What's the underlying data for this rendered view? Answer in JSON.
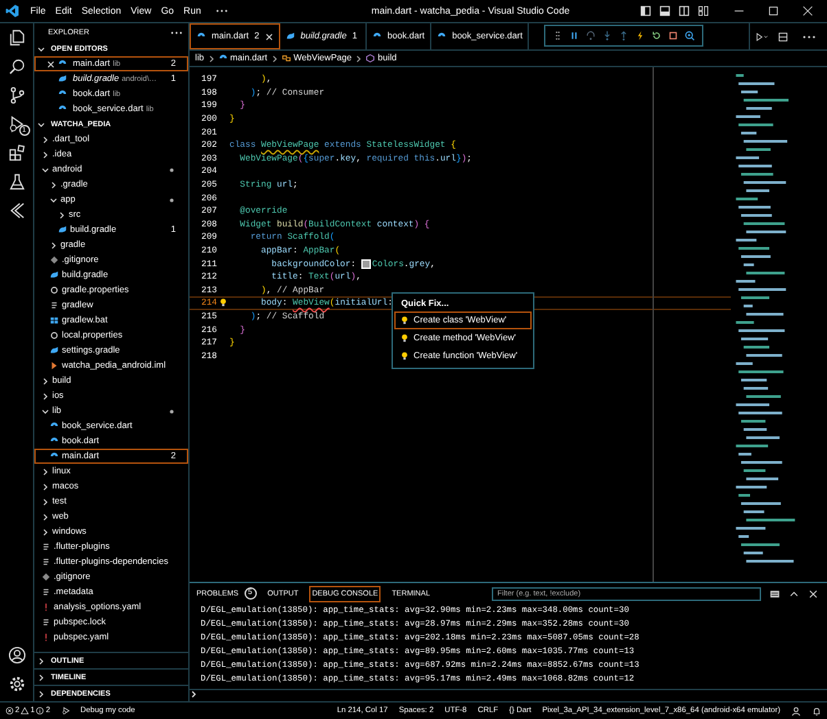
{
  "title_bar": {
    "menu": [
      "File",
      "Edit",
      "Selection",
      "View",
      "Go",
      "Run"
    ],
    "title": "main.dart - watcha_pedia - Visual Studio Code"
  },
  "activity_bar": {
    "items": [
      {
        "kind": "files"
      },
      {
        "kind": "search"
      },
      {
        "kind": "source-control"
      },
      {
        "kind": "debug",
        "badge": "1"
      },
      {
        "kind": "extensions"
      },
      {
        "kind": "testing"
      },
      {
        "kind": "flutter"
      }
    ],
    "bottom": [
      {
        "kind": "account"
      },
      {
        "kind": "settings"
      }
    ]
  },
  "sidebar": {
    "title": "EXPLORER",
    "open_editors": {
      "title": "OPEN EDITORS",
      "expanded": true,
      "items": [
        {
          "name": "main.dart",
          "detail": "lib",
          "badge": "2",
          "kind": "dart",
          "preview": false,
          "selected": true
        },
        {
          "name": "build.gradle",
          "detail": "android\\…",
          "badge": "1",
          "kind": "gradle",
          "preview": true,
          "selected": false
        },
        {
          "name": "book.dart",
          "detail": "lib",
          "kind": "dart",
          "preview": false,
          "selected": false
        },
        {
          "name": "book_service.dart",
          "detail": "lib",
          "kind": "dart",
          "preview": false,
          "selected": false
        }
      ]
    },
    "folder": {
      "title": "WATCHA_PEDIA",
      "expanded": true,
      "tree": [
        {
          "name": ".dart_tool",
          "kind": "folder",
          "expanded": false,
          "marked": false,
          "selected": false
        },
        {
          "name": ".idea",
          "kind": "folder",
          "expanded": false,
          "marked": false,
          "selected": false
        },
        {
          "name": "android",
          "kind": "folder",
          "expanded": true,
          "marked": true,
          "selected": false,
          "children": [
            {
              "name": ".gradle",
              "kind": "folder",
              "expanded": false,
              "marked": false,
              "selected": false
            },
            {
              "name": "app",
              "kind": "folder",
              "expanded": true,
              "marked": true,
              "selected": false,
              "children": [
                {
                  "name": "src",
                  "kind": "folder",
                  "expanded": false,
                  "marked": false,
                  "selected": false
                },
                {
                  "name": "build.gradle",
                  "kind": "gradle",
                  "badge": "1",
                  "marked": false,
                  "selected": false
                }
              ]
            },
            {
              "name": "gradle",
              "kind": "folder",
              "expanded": false,
              "marked": false,
              "selected": false
            },
            {
              "name": ".gitignore",
              "kind": "git",
              "marked": false,
              "selected": false
            },
            {
              "name": "build.gradle",
              "kind": "gradle",
              "marked": false,
              "selected": false
            },
            {
              "name": "gradle.properties",
              "kind": "config",
              "marked": false,
              "selected": false
            },
            {
              "name": "gradlew",
              "kind": "text",
              "marked": false,
              "selected": false
            },
            {
              "name": "gradlew.bat",
              "kind": "windows",
              "marked": false,
              "selected": false
            },
            {
              "name": "local.properties",
              "kind": "config",
              "marked": false,
              "selected": false
            },
            {
              "name": "settings.gradle",
              "kind": "gradle",
              "marked": false,
              "selected": false
            },
            {
              "name": "watcha_pedia_android.iml",
              "kind": "xml",
              "marked": false,
              "selected": false
            }
          ]
        },
        {
          "name": "build",
          "kind": "folder",
          "expanded": false,
          "marked": false,
          "selected": false
        },
        {
          "name": "ios",
          "kind": "folder",
          "expanded": false,
          "marked": false,
          "selected": false
        },
        {
          "name": "lib",
          "kind": "folder",
          "expanded": true,
          "marked": true,
          "selected": false,
          "children": [
            {
              "name": "book_service.dart",
              "kind": "dart",
              "marked": false,
              "selected": false
            },
            {
              "name": "book.dart",
              "kind": "dart",
              "marked": false,
              "selected": false
            },
            {
              "name": "main.dart",
              "kind": "dart",
              "badge": "2",
              "marked": false,
              "selected": true
            }
          ]
        },
        {
          "name": "linux",
          "kind": "folder",
          "expanded": false,
          "marked": false,
          "selected": false
        },
        {
          "name": "macos",
          "kind": "folder",
          "expanded": false,
          "marked": false,
          "selected": false
        },
        {
          "name": "test",
          "kind": "folder",
          "expanded": false,
          "marked": false,
          "selected": false
        },
        {
          "name": "web",
          "kind": "folder",
          "expanded": false,
          "marked": false,
          "selected": false
        },
        {
          "name": "windows",
          "kind": "folder",
          "expanded": false,
          "marked": false,
          "selected": false
        },
        {
          "name": ".flutter-plugins",
          "kind": "text",
          "marked": false,
          "selected": false
        },
        {
          "name": ".flutter-plugins-dependencies",
          "kind": "text",
          "marked": false,
          "selected": false
        },
        {
          "name": ".gitignore",
          "kind": "git",
          "marked": false,
          "selected": false
        },
        {
          "name": ".metadata",
          "kind": "text",
          "marked": false,
          "selected": false
        },
        {
          "name": "analysis_options.yaml",
          "kind": "yaml",
          "marked": false,
          "selected": false
        },
        {
          "name": "pubspec.lock",
          "kind": "text",
          "marked": false,
          "selected": false
        },
        {
          "name": "pubspec.yaml",
          "kind": "yaml",
          "marked": false,
          "selected": false
        }
      ]
    },
    "sections": [
      {
        "title": "OUTLINE",
        "expanded": false
      },
      {
        "title": "TIMELINE",
        "expanded": false
      },
      {
        "title": "DEPENDENCIES",
        "expanded": false
      }
    ]
  },
  "tabs": [
    {
      "name": "main.dart",
      "badge": "2",
      "kind": "dart",
      "preview": false,
      "selected": true
    },
    {
      "name": "build.gradle",
      "badge": "1",
      "kind": "gradle",
      "preview": true,
      "selected": false
    },
    {
      "name": "book.dart",
      "kind": "dart",
      "preview": false,
      "selected": false
    },
    {
      "name": "book_service.dart",
      "kind": "dart",
      "preview": false,
      "selected": false
    }
  ],
  "debug_toolbar": {
    "items": [
      {
        "kind": "grip"
      },
      {
        "kind": "pause"
      },
      {
        "kind": "step-over"
      },
      {
        "kind": "step-into"
      },
      {
        "kind": "step-out"
      },
      {
        "kind": "hot-reload"
      },
      {
        "kind": "restart"
      },
      {
        "kind": "stop"
      },
      {
        "kind": "inspect"
      }
    ]
  },
  "breadcrumb": [
    {
      "label": "lib",
      "kind": "folder"
    },
    {
      "label": "main.dart",
      "kind": "dart"
    },
    {
      "label": "WebViewPage",
      "kind": "class"
    },
    {
      "label": "build",
      "kind": "method"
    }
  ],
  "editor": {
    "lines": [
      {
        "number": "197",
        "current": false,
        "lightbulb": false,
        "tokens": [
          {
            "kind": "bracket1",
            "text": "      )"
          },
          {
            "kind": "plain",
            "text": ","
          }
        ]
      },
      {
        "number": "198",
        "current": false,
        "lightbulb": false,
        "tokens": [
          {
            "kind": "bracket3",
            "text": "    )"
          },
          {
            "kind": "plain",
            "text": "; "
          },
          {
            "kind": "comment",
            "text": "// Consumer"
          }
        ]
      },
      {
        "number": "199",
        "current": false,
        "lightbulb": false,
        "tokens": [
          {
            "kind": "bracket2",
            "text": "  }"
          }
        ]
      },
      {
        "number": "200",
        "current": false,
        "lightbulb": false,
        "tokens": [
          {
            "kind": "bracket1",
            "text": "}"
          }
        ]
      },
      {
        "number": "201",
        "current": false,
        "lightbulb": false
      },
      {
        "number": "202",
        "current": false,
        "lightbulb": false,
        "tokens": [
          {
            "kind": "keyword",
            "text": "class "
          },
          {
            "kind": "type",
            "text": "WebViewPage",
            "warning": true
          },
          {
            "kind": "keyword",
            "text": " extends "
          },
          {
            "kind": "type",
            "text": "StatelessWidget "
          },
          {
            "kind": "bracket1",
            "text": "{"
          }
        ]
      },
      {
        "number": "203",
        "current": false,
        "lightbulb": false,
        "tokens": [
          {
            "kind": "type",
            "text": "  WebViewPage"
          },
          {
            "kind": "bracket2",
            "text": "("
          },
          {
            "kind": "bracket3",
            "text": "{"
          },
          {
            "kind": "keyword",
            "text": "super"
          },
          {
            "kind": "plain",
            "text": "."
          },
          {
            "kind": "variable",
            "text": "key"
          },
          {
            "kind": "plain",
            "text": ", "
          },
          {
            "kind": "keyword",
            "text": "required this"
          },
          {
            "kind": "plain",
            "text": "."
          },
          {
            "kind": "variable",
            "text": "url"
          },
          {
            "kind": "bracket3",
            "text": "}"
          },
          {
            "kind": "bracket2",
            "text": ")"
          },
          {
            "kind": "plain",
            "text": ";"
          }
        ]
      },
      {
        "number": "204",
        "current": false,
        "lightbulb": false
      },
      {
        "number": "205",
        "current": false,
        "lightbulb": false,
        "tokens": [
          {
            "kind": "type",
            "text": "  String "
          },
          {
            "kind": "variable",
            "text": "url"
          },
          {
            "kind": "plain",
            "text": ";"
          }
        ]
      },
      {
        "number": "206",
        "current": false,
        "lightbulb": false
      },
      {
        "number": "207",
        "current": false,
        "lightbulb": false,
        "tokens": [
          {
            "kind": "decorator",
            "text": "  @override"
          }
        ]
      },
      {
        "number": "208",
        "current": false,
        "lightbulb": false,
        "tokens": [
          {
            "kind": "type",
            "text": "  Widget "
          },
          {
            "kind": "function",
            "text": "build"
          },
          {
            "kind": "bracket2",
            "text": "("
          },
          {
            "kind": "type",
            "text": "BuildContext "
          },
          {
            "kind": "variable",
            "text": "context"
          },
          {
            "kind": "bracket2",
            "text": ") {"
          }
        ]
      },
      {
        "number": "209",
        "current": false,
        "lightbulb": false,
        "tokens": [
          {
            "kind": "keyword",
            "text": "    return "
          },
          {
            "kind": "type",
            "text": "Scaffold"
          },
          {
            "kind": "bracket3",
            "text": "("
          }
        ]
      },
      {
        "number": "210",
        "current": false,
        "lightbulb": false,
        "tokens": [
          {
            "kind": "variable",
            "text": "      appBar"
          },
          {
            "kind": "plain",
            "text": ": "
          },
          {
            "kind": "type",
            "text": "AppBar"
          },
          {
            "kind": "bracket1",
            "text": "("
          }
        ]
      },
      {
        "number": "211",
        "current": false,
        "lightbulb": false,
        "tokens": [
          {
            "kind": "variable",
            "text": "        backgroundColor"
          },
          {
            "kind": "plain",
            "text": ": "
          },
          {
            "kind": "swatch",
            "color": "#9e9e9e"
          },
          {
            "kind": "type",
            "text": "Colors"
          },
          {
            "kind": "plain",
            "text": "."
          },
          {
            "kind": "variable",
            "text": "grey"
          },
          {
            "kind": "plain",
            "text": ","
          }
        ]
      },
      {
        "number": "212",
        "current": false,
        "lightbulb": false,
        "tokens": [
          {
            "kind": "variable",
            "text": "        title"
          },
          {
            "kind": "plain",
            "text": ": "
          },
          {
            "kind": "type",
            "text": "Text"
          },
          {
            "kind": "bracket2",
            "text": "("
          },
          {
            "kind": "variable",
            "text": "url"
          },
          {
            "kind": "bracket2",
            "text": ")"
          },
          {
            "kind": "plain",
            "text": ","
          }
        ]
      },
      {
        "number": "213",
        "current": false,
        "lightbulb": false,
        "tokens": [
          {
            "kind": "bracket1",
            "text": "      )"
          },
          {
            "kind": "plain",
            "text": ", "
          },
          {
            "kind": "comment",
            "text": "// AppBar"
          }
        ]
      },
      {
        "number": "214",
        "current": true,
        "lightbulb": true,
        "tokens": [
          {
            "kind": "variable",
            "text": "      body"
          },
          {
            "kind": "plain",
            "text": ": "
          },
          {
            "kind": "type",
            "text": "WebView",
            "error": true
          },
          {
            "kind": "bracket1",
            "text": "("
          },
          {
            "kind": "variable",
            "text": "initialUrl"
          },
          {
            "kind": "plain",
            "text": ":"
          }
        ]
      },
      {
        "number": "215",
        "current": false,
        "lightbulb": false,
        "tokens": [
          {
            "kind": "bracket3",
            "text": "    )"
          },
          {
            "kind": "plain",
            "text": "; "
          },
          {
            "kind": "comment",
            "text": "// Scaffold"
          }
        ]
      },
      {
        "number": "216",
        "current": false,
        "lightbulb": false,
        "tokens": [
          {
            "kind": "bracket2",
            "text": "  }"
          }
        ]
      },
      {
        "number": "217",
        "current": false,
        "lightbulb": false,
        "tokens": [
          {
            "kind": "bracket1",
            "text": "}"
          }
        ]
      },
      {
        "number": "218",
        "current": false,
        "lightbulb": false
      }
    ],
    "quick_fix": {
      "title": "Quick Fix...",
      "items": [
        {
          "label": "Create class 'WebView'",
          "selected": true
        },
        {
          "label": "Create method 'WebView'",
          "selected": false
        },
        {
          "label": "Create function 'WebView'",
          "selected": false
        }
      ]
    }
  },
  "panel": {
    "tabs": [
      {
        "label": "PROBLEMS",
        "badge": "5",
        "selected": false
      },
      {
        "label": "OUTPUT",
        "selected": false
      },
      {
        "label": "DEBUG CONSOLE",
        "selected": true
      },
      {
        "label": "TERMINAL",
        "selected": false
      }
    ],
    "filter": {
      "placeholder": "Filter (e.g. text, !exclude)"
    },
    "lines": [
      "D/EGL_emulation(13850): app_time_stats: avg=32.90ms min=2.23ms max=348.00ms count=30",
      "D/EGL_emulation(13850): app_time_stats: avg=28.97ms min=2.29ms max=352.28ms count=30",
      "D/EGL_emulation(13850): app_time_stats: avg=202.18ms min=2.23ms max=5087.05ms count=28",
      "D/EGL_emulation(13850): app_time_stats: avg=89.95ms min=2.60ms max=1035.77ms count=13",
      "D/EGL_emulation(13850): app_time_stats: avg=687.92ms min=2.24ms max=8852.67ms count=13",
      "D/EGL_emulation(13850): app_time_stats: avg=95.17ms min=2.49ms max=1068.82ms count=12"
    ]
  },
  "status_bar": {
    "errors": "2",
    "warnings": "1",
    "infos": "2",
    "debug": "Debug my code",
    "items": [
      "Ln 214, Col 17",
      "Spaces: 2",
      "UTF-8",
      "CRLF",
      "{} Dart",
      "Pixel_3a_API_34_extension_level_7_x86_64 (android-x64 emulator)"
    ]
  }
}
